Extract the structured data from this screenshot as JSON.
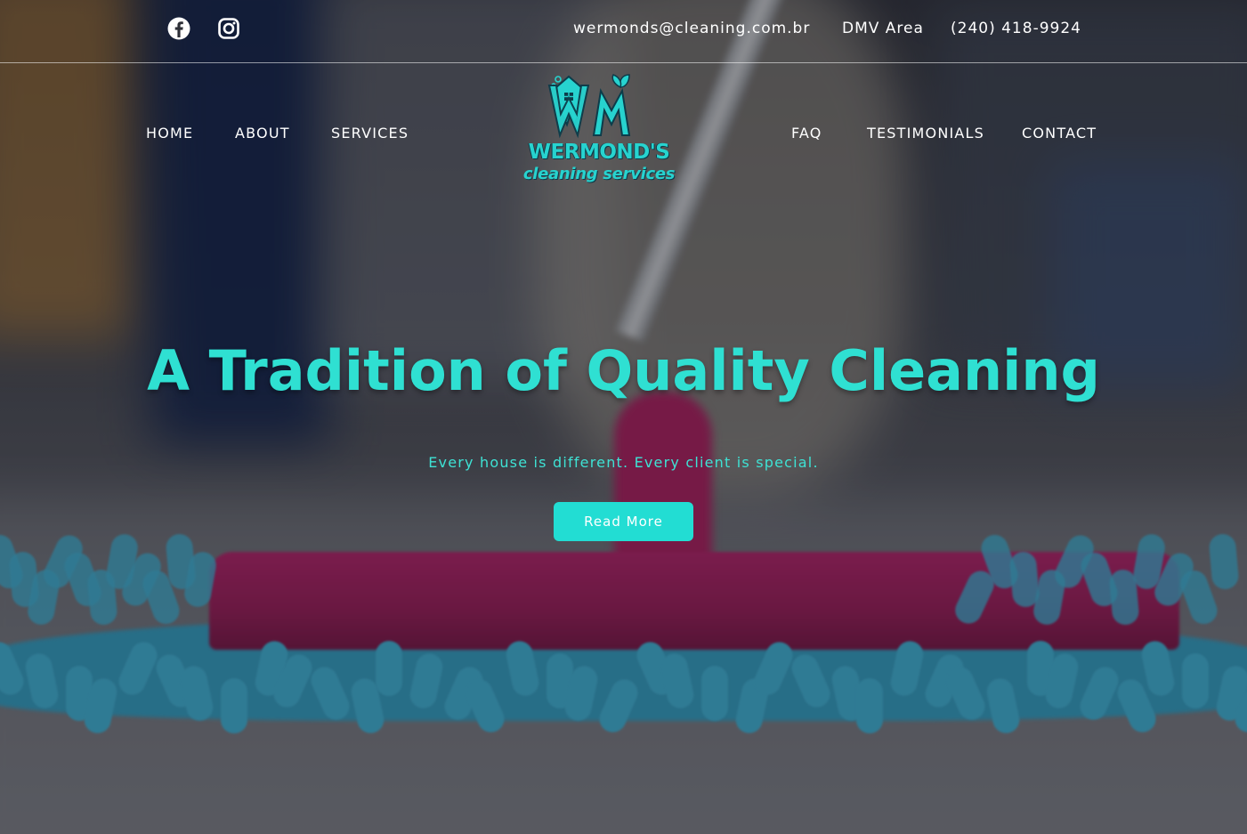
{
  "topbar": {
    "social": [
      {
        "icon": "facebook-icon"
      },
      {
        "icon": "instagram-icon"
      }
    ],
    "email": "wermonds@cleaning.com.br",
    "area": "DMV Area",
    "phone": "(240) 418-9924"
  },
  "nav": {
    "left": [
      "HOME",
      "ABOUT",
      "SERVICES"
    ],
    "right": [
      "FAQ",
      "TESTIMONIALS",
      "CONTACT"
    ]
  },
  "logo": {
    "title": "WERMOND'S",
    "subtitle": "cleaning services",
    "color": "#27d3cf"
  },
  "hero": {
    "title": "A Tradition of Quality Cleaning",
    "subtitle": "Every house is different. Every client is special.",
    "button_label": "Read More",
    "accent_color": "#22ddd3"
  }
}
